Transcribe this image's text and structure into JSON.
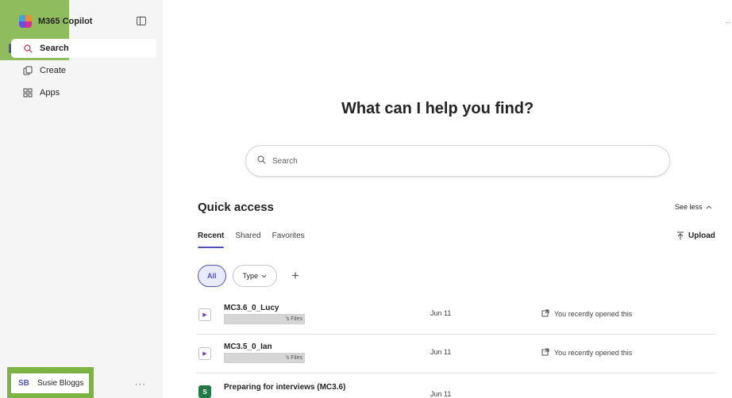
{
  "sidebar": {
    "brand": "M365 Copilot",
    "items": [
      {
        "label": "Search",
        "icon": "search-icon"
      },
      {
        "label": "Create",
        "icon": "create-icon"
      },
      {
        "label": "Apps",
        "icon": "apps-icon"
      }
    ],
    "user": {
      "initials": "SB",
      "name": "Susie Bloggs"
    },
    "more": "···"
  },
  "main": {
    "heading": "What can I help you find?",
    "search_placeholder": "Search",
    "quick_access": {
      "title": "Quick access",
      "see_less": "See less",
      "tabs": [
        "Recent",
        "Shared",
        "Favorites"
      ],
      "upload": "Upload",
      "filters": {
        "all": "All",
        "type": "Type"
      },
      "files": [
        {
          "name": "MC3.6_0_Lucy",
          "owner": "'s Files",
          "date": "Jun 11",
          "activity": "You recently opened this",
          "type": "video"
        },
        {
          "name": "MC3.5_0_Ian",
          "owner": "'s Files",
          "date": "Jun 11",
          "activity": "You recently opened this",
          "type": "video"
        },
        {
          "name": "Preparing for interviews (MC3.6)",
          "owner": "",
          "date": "Jun 11",
          "activity": "",
          "type": "spreadsheet"
        }
      ]
    }
  },
  "colors": {
    "accent": "#4f52b2",
    "highlight": "#7cb342",
    "sidebar_bg": "#f5f5f5"
  }
}
